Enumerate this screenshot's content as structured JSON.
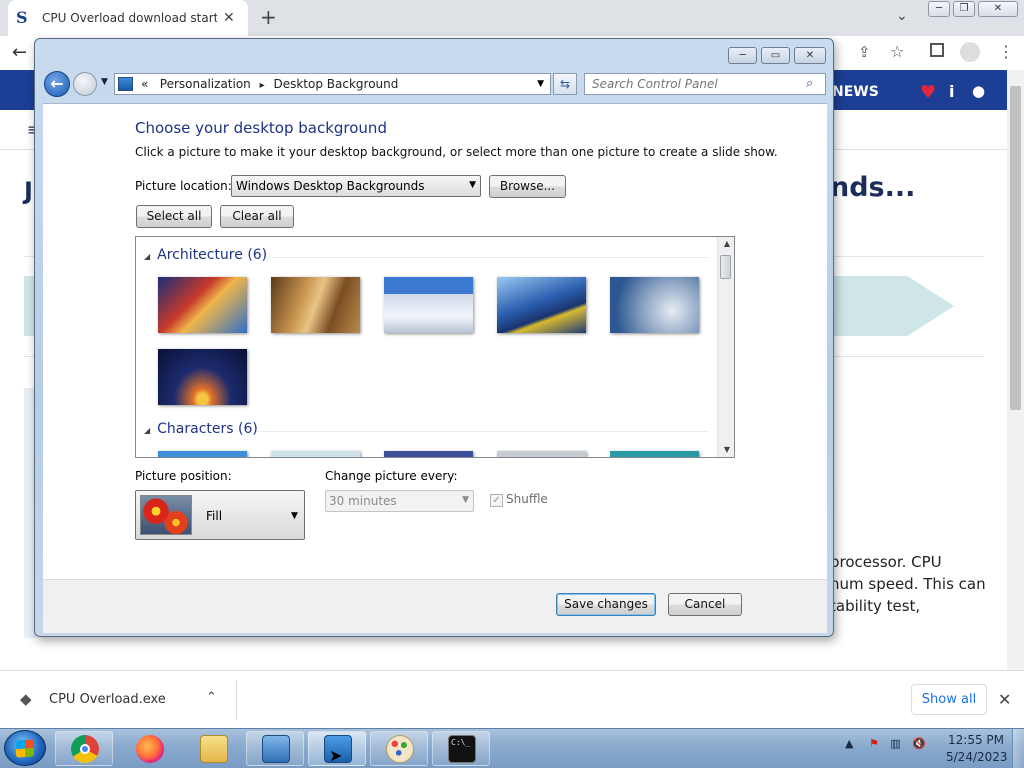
{
  "browser": {
    "tab_title": "CPU Overload download starting",
    "tab_close": "✕",
    "new_tab": "+",
    "tab_dropdown": "⌄",
    "back": "←",
    "site_nav": "NEWS",
    "heading_fragment": "nds...",
    "article_lines": [
      "processor. CPU",
      "num speed. This can",
      "tability test,"
    ],
    "download_file": "CPU Overload.exe",
    "show_all": "Show all",
    "download_close": "✕"
  },
  "window": {
    "nav_back": "←",
    "breadcrumb_prefix": "«",
    "breadcrumb": [
      "Personalization",
      "Desktop Background"
    ],
    "breadcrumb_sep": "▸",
    "search_placeholder": "Search Control Panel",
    "title": "Choose your desktop background",
    "description": "Click a picture to make it your desktop background, or select more than one picture to create a slide show.",
    "picture_location_label": "Picture location:",
    "picture_location_value": "Windows Desktop Backgrounds",
    "browse_label": "Browse...",
    "select_all_label": "Select all",
    "clear_all_label": "Clear all",
    "groups": [
      {
        "name": "Architecture (6)"
      },
      {
        "name": "Characters (6)"
      }
    ],
    "picture_position_label": "Picture position:",
    "picture_position_value": "Fill",
    "change_every_label": "Change picture every:",
    "change_every_value": "30 minutes",
    "shuffle_label": "Shuffle",
    "shuffle_checked": true,
    "save_label": "Save changes",
    "cancel_label": "Cancel"
  },
  "taskbar": {
    "time": "12:55 PM",
    "date": "5/24/2023",
    "apps": [
      "chrome",
      "firefox",
      "explorer",
      "picture-viewer",
      "control-panel",
      "paint",
      "cmd"
    ],
    "cmd_glyph": "C:\\_"
  }
}
